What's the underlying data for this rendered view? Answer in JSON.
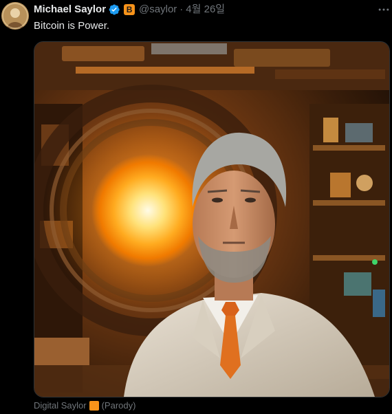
{
  "tweet": {
    "author": {
      "display_name": "Michael Saylor",
      "handle": "@saylor",
      "verified_icon": "verified-badge-icon",
      "affiliation_badge": "B",
      "affiliation_color": "#f7931a"
    },
    "separator": "·",
    "timestamp": "4월 26일",
    "text": "Bitcoin is Power.",
    "more_icon": "more-options-icon",
    "media": {
      "caption_name": "Digital Saylor",
      "caption_suffix": "(Parody)",
      "badge_color": "#f7931a"
    }
  },
  "colors": {
    "background": "#000000",
    "primary_text": "#e7e9ea",
    "secondary_text": "#71767b",
    "verified_blue": "#1d9bf0"
  }
}
